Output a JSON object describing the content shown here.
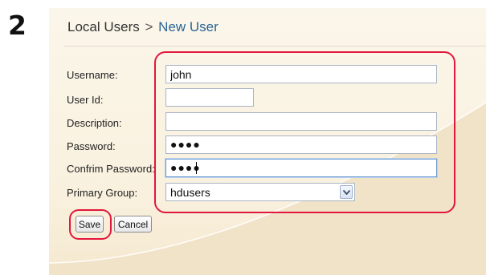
{
  "step_number": "2",
  "breadcrumb": {
    "parent": "Local Users",
    "separator": ">",
    "current": "New User"
  },
  "form": {
    "username": {
      "label": "Username:",
      "value": "john"
    },
    "user_id": {
      "label": "User Id:",
      "value": ""
    },
    "description": {
      "label": "Description:",
      "value": ""
    },
    "password": {
      "label": "Password:",
      "masked_value": "●●●●"
    },
    "confirm_password": {
      "label": "Confrim Password:",
      "masked_value": "●●●●"
    },
    "primary_group": {
      "label": "Primary Group:",
      "selected": "hdusers"
    }
  },
  "buttons": {
    "save": "Save",
    "cancel": "Cancel"
  },
  "colors": {
    "highlight": "#e2173c",
    "link": "#2a6496",
    "panel_background": "#f9f1de",
    "input_border": "#a9b4c4"
  },
  "icons": {
    "dropdown": "chevron-down-icon"
  }
}
